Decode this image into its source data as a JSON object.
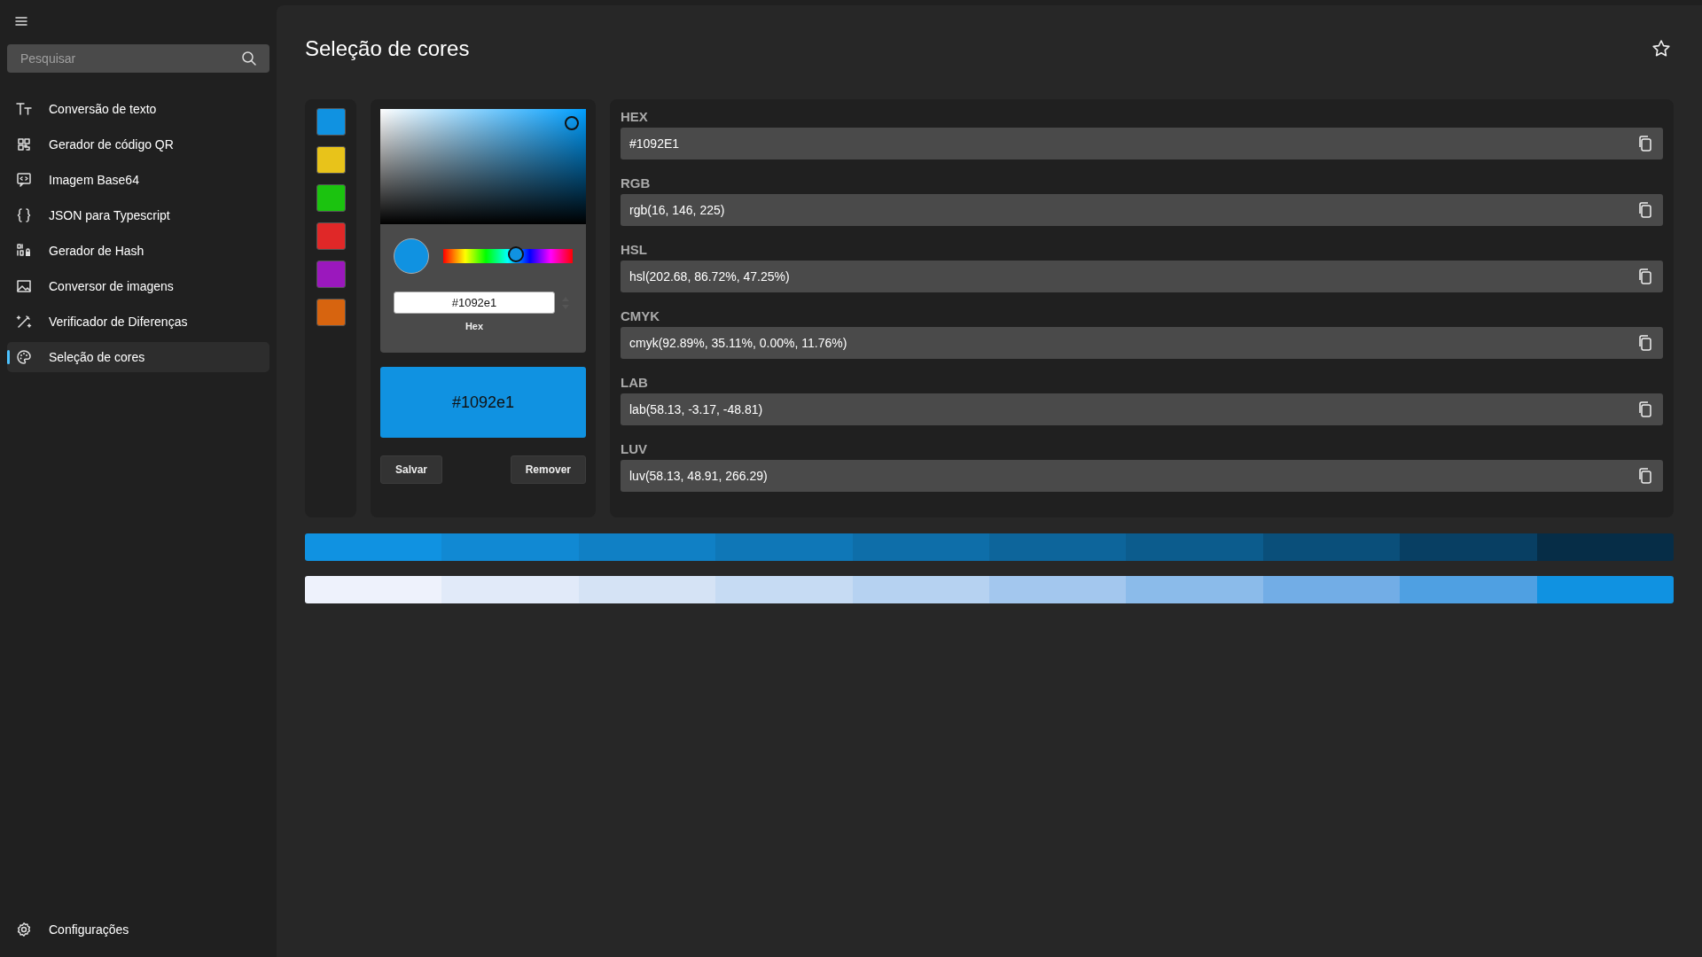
{
  "sidebar": {
    "search": {
      "placeholder": "Pesquisar"
    },
    "items": [
      {
        "label": "Conversão de texto",
        "selected": false
      },
      {
        "label": "Gerador de código QR",
        "selected": false
      },
      {
        "label": "Imagem Base64",
        "selected": false
      },
      {
        "label": "JSON para Typescript",
        "selected": false
      },
      {
        "label": "Gerador de Hash",
        "selected": false
      },
      {
        "label": "Conversor de imagens",
        "selected": false
      },
      {
        "label": "Verificador de Diferenças",
        "selected": false
      },
      {
        "label": "Seleção de cores",
        "selected": true
      }
    ],
    "footer": {
      "label": "Configurações"
    }
  },
  "page": {
    "title": "Seleção de cores",
    "favorite": false
  },
  "saved_colors": [
    {
      "color": "#1092e1"
    },
    {
      "color": "#e8c31a"
    },
    {
      "color": "#1bc30f"
    },
    {
      "color": "#e02828"
    },
    {
      "color": "#9b18bd"
    },
    {
      "color": "#d7640f"
    }
  ],
  "picker": {
    "color": "#1092e1",
    "saturation": {
      "level": 0.93
    },
    "brightness": {
      "level": 0.88
    },
    "hue": {
      "level": 0.563
    },
    "hex_value": "#1092e1",
    "hex_label": "Hex",
    "preview_text": "#1092e1",
    "buttons": [
      "Salvar",
      "Remover"
    ]
  },
  "formats": [
    {
      "label": "HEX",
      "value": "#1092E1"
    },
    {
      "label": "RGB",
      "value": "rgb(16, 146, 225)"
    },
    {
      "label": "HSL",
      "value": "hsl(202.68, 86.72%, 47.25%)"
    },
    {
      "label": "CMYK",
      "value": "cmyk(92.89%, 35.11%, 0.00%, 11.76%)"
    },
    {
      "label": "LAB",
      "value": "lab(58.13, -3.17, -48.81)"
    },
    {
      "label": "LUV",
      "value": "luv(58.13, 48.91, 266.29)"
    }
  ],
  "shades": [
    {
      "color": "#1092e1"
    },
    {
      "color": "#1189d3"
    },
    {
      "color": "#1080c5"
    },
    {
      "color": "#0f77b7"
    },
    {
      "color": "#0e6ea9"
    },
    {
      "color": "#0d659b"
    },
    {
      "color": "#0c5c8d"
    },
    {
      "color": "#0a4f7a"
    },
    {
      "color": "#083f63"
    },
    {
      "color": "#062d47"
    }
  ],
  "tints": [
    {
      "color": "#eef2fc"
    },
    {
      "color": "#e1eaf9"
    },
    {
      "color": "#d5e3f5"
    },
    {
      "color": "#c6dbf3"
    },
    {
      "color": "#b6d2f1"
    },
    {
      "color": "#a3c7ee"
    },
    {
      "color": "#8bbbea"
    },
    {
      "color": "#72ade6"
    },
    {
      "color": "#4fa0e2"
    },
    {
      "color": "#1092e1"
    }
  ]
}
